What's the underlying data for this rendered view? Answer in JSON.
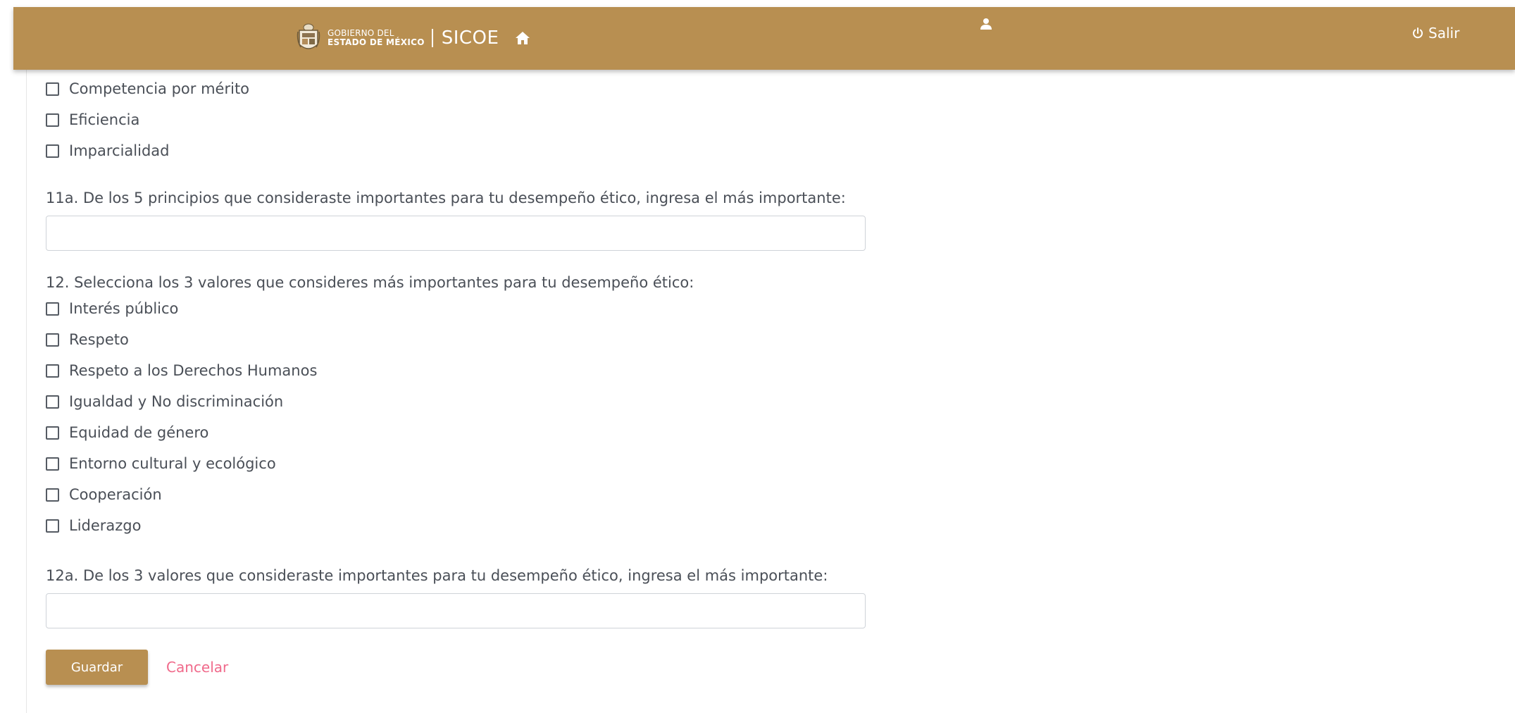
{
  "header": {
    "gov_line1": "GOBIERNO DEL",
    "gov_line2": "ESTADO DE MÉXICO",
    "app_name": "SICOE",
    "logout_label": "Salir",
    "brand_color": "#b88f51",
    "icons": [
      "state-seal-icon",
      "home-icon",
      "user-icon",
      "power-icon"
    ]
  },
  "principles_tail": [
    {
      "label": "Competencia por mérito",
      "checked": false
    },
    {
      "label": "Eficiencia",
      "checked": false
    },
    {
      "label": "Imparcialidad",
      "checked": false
    }
  ],
  "q11a": {
    "label": "11a. De los 5 principios que consideraste importantes para tu desempeño ético, ingresa el más importante:",
    "value": ""
  },
  "q12": {
    "label": "12. Selecciona los 3 valores que consideres más importantes para tu desempeño ético:",
    "options": [
      {
        "label": "Interés público",
        "checked": false
      },
      {
        "label": "Respeto",
        "checked": false
      },
      {
        "label": "Respeto a los Derechos Humanos",
        "checked": false
      },
      {
        "label": "Igualdad y No discriminación",
        "checked": false
      },
      {
        "label": "Equidad de género",
        "checked": false
      },
      {
        "label": "Entorno cultural y ecológico",
        "checked": false
      },
      {
        "label": "Cooperación",
        "checked": false
      },
      {
        "label": "Liderazgo",
        "checked": false
      }
    ]
  },
  "q12a": {
    "label": "12a. De los 3 valores que consideraste importantes para tu desempeño ético, ingresa el más importante:",
    "value": ""
  },
  "actions": {
    "save_label": "Guardar",
    "cancel_label": "Cancelar",
    "cancel_color": "#f06a8b"
  }
}
